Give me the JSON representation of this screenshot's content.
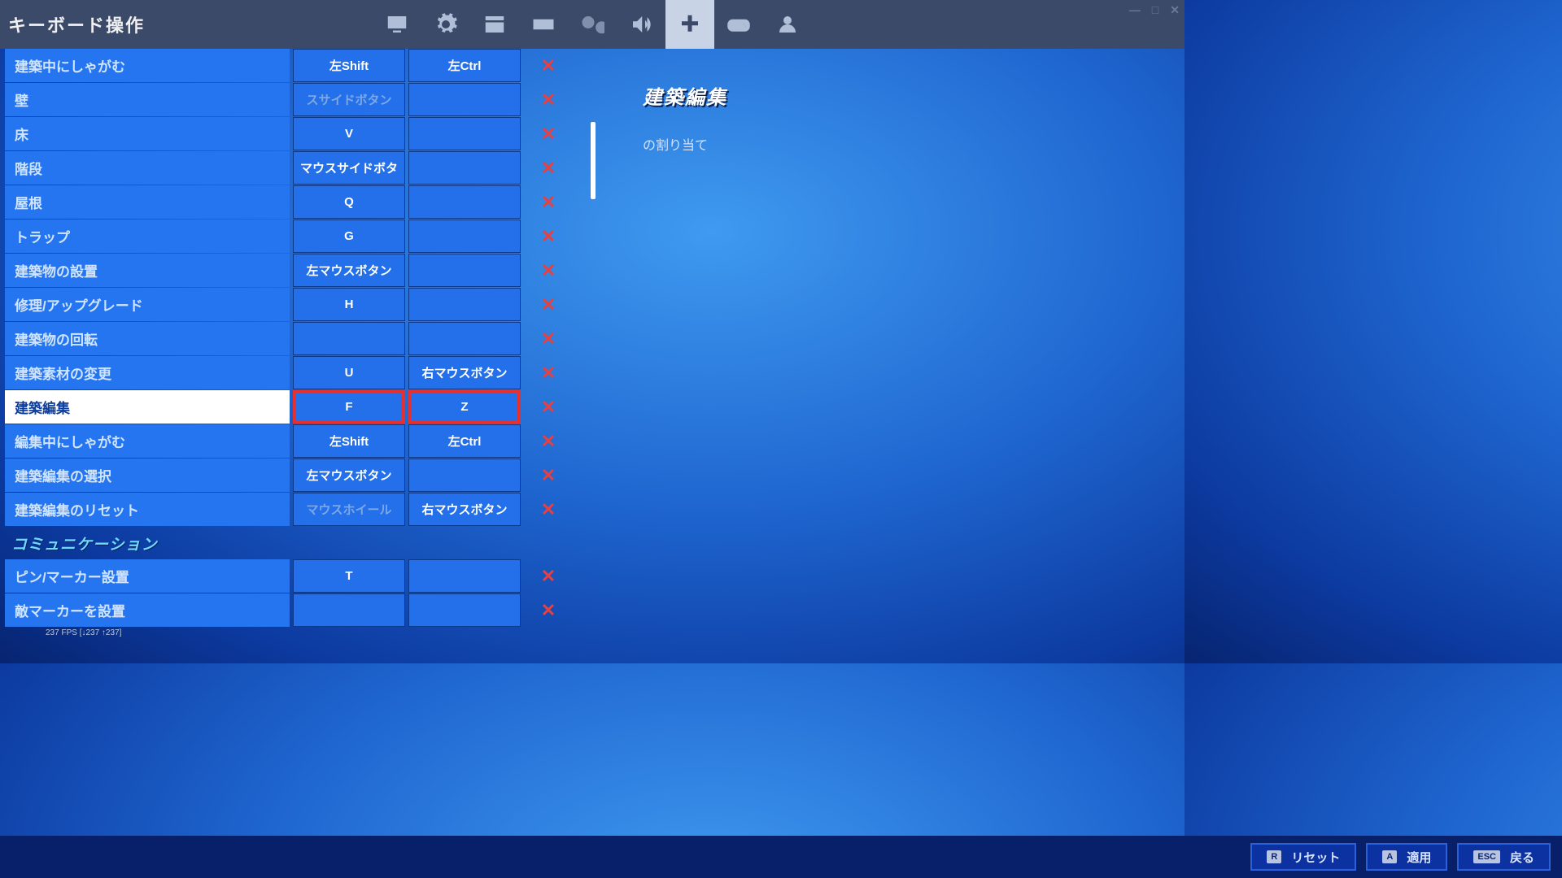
{
  "title": "キーボード操作",
  "tabs": [
    "display",
    "gear",
    "panel",
    "keyboard",
    "wrench",
    "audio",
    "dpad",
    "gamepad",
    "user"
  ],
  "active_tab_index": 6,
  "right": {
    "title": "建築編集",
    "desc": "の割り当て"
  },
  "sections": {
    "s1": "コミュニケーション"
  },
  "rows": [
    {
      "label": "建築中にしゃがむ",
      "k1": "左Shift",
      "k2": "左Ctrl",
      "highlight": false
    },
    {
      "label": "壁",
      "k1": "スサイドボタン",
      "k2": "",
      "dim1": true,
      "highlight": false
    },
    {
      "label": "床",
      "k1": "V",
      "k2": "",
      "highlight": false
    },
    {
      "label": "階段",
      "k1": "マウスサイドボタ",
      "k2": "",
      "highlight": false
    },
    {
      "label": "屋根",
      "k1": "Q",
      "k2": "",
      "highlight": false
    },
    {
      "label": "トラップ",
      "k1": "G",
      "k2": "",
      "highlight": false
    },
    {
      "label": "建築物の設置",
      "k1": "左マウスボタン",
      "k2": "",
      "highlight": false
    },
    {
      "label": "修理/アップグレード",
      "k1": "H",
      "k2": "",
      "highlight": false
    },
    {
      "label": "建築物の回転",
      "k1": "",
      "k2": "",
      "highlight": false
    },
    {
      "label": "建築素材の変更",
      "k1": "U",
      "k2": "右マウスボタン",
      "highlight": false
    },
    {
      "label": "建築編集",
      "k1": "F",
      "k2": "Z",
      "highlight": true
    },
    {
      "label": "編集中にしゃがむ",
      "k1": "左Shift",
      "k2": "左Ctrl",
      "highlight": false
    },
    {
      "label": "建築編集の選択",
      "k1": "左マウスボタン",
      "k2": "",
      "highlight": false
    },
    {
      "label": "建築編集のリセット",
      "k1": "マウスホイール",
      "k2": "右マウスボタン",
      "dim1": true,
      "highlight": false
    }
  ],
  "rows2": [
    {
      "label": "ピン/マーカー設置",
      "k1": "T",
      "k2": ""
    },
    {
      "label": "敵マーカーを設置",
      "k1": "",
      "k2": ""
    }
  ],
  "fps": "237 FPS [↓237 ↑237]",
  "footer": [
    {
      "key": "R",
      "label": "リセット"
    },
    {
      "key": "A",
      "label": "適用"
    },
    {
      "key": "ESC",
      "label": "戻る"
    }
  ],
  "win": {
    "min": "—",
    "max": "□",
    "close": "✕"
  }
}
